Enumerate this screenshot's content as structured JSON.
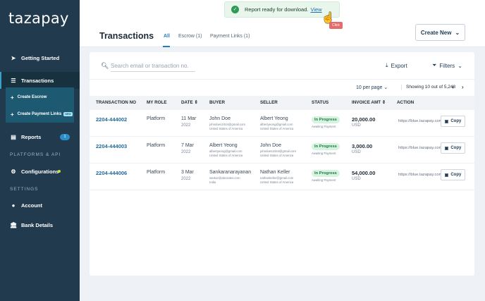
{
  "app": {
    "logo": "tazapay"
  },
  "sidebar": {
    "getting_started": "Getting Started",
    "transactions": "Transactions",
    "create_escrow": "Create Escrow",
    "create_payment_links": "Create Payment Links",
    "new_badge": "NEW",
    "reports": "Reports",
    "reports_count": "1",
    "platforms_api_label": "PLATFORMS & API",
    "configurations": "Configurations",
    "settings_label": "SETTINGS",
    "account": "Account",
    "bank_details": "Bank Details"
  },
  "header": {
    "title": "Transactions",
    "tabs": [
      {
        "label": "All"
      },
      {
        "label": "Escrow (1)"
      },
      {
        "label": "Payment Links (1)"
      }
    ],
    "create_new": "Create New"
  },
  "toast": {
    "message": "Report ready for download.",
    "link": "View",
    "tooltip": "Click"
  },
  "toolbar": {
    "search_placeholder": "Search email or transaction no.",
    "export": "Export",
    "filters": "Filters",
    "per_page": "10 per page",
    "showing": "Showing 10 out of 5,248"
  },
  "table": {
    "headers": [
      "TRANSACTION NO",
      "MY ROLE",
      "DATE",
      "BUYER",
      "SELLER",
      "STATUS",
      "INVOICE AMT",
      "ACTION"
    ],
    "rows": [
      {
        "txn": "2204-444002",
        "role": "Platform",
        "date": "11 Mar",
        "year": "2022",
        "buyer": "John Doe",
        "buyer_email": "johndoes2444@gmail.com",
        "buyer_country": "United States of America",
        "seller": "Albert Yeong",
        "seller_email": "albertyeong@gmail.com",
        "seller_country": "United States of America",
        "status": "In Progress",
        "status_sub": "Awaiting Payment",
        "amount": "20,000.00",
        "currency": "USD",
        "link": "https://blue.tazapay.com",
        "copy": "Copy"
      },
      {
        "txn": "2204-444003",
        "role": "Platform",
        "date": "7 Mar",
        "year": "2022",
        "buyer": "Albert Yeong",
        "buyer_email": "albertyeong@gmail.com",
        "buyer_country": "United States of America",
        "seller": "John Doe",
        "seller_email": "johndoes2444@gmail.com",
        "seller_country": "United States of America",
        "status": "In Progress",
        "status_sub": "Awaiting Payment",
        "amount": "3,000.00",
        "currency": "USD",
        "link": "https://blue.tazapay.com",
        "copy": "Copy"
      },
      {
        "txn": "2204-444006",
        "role": "Platform",
        "date": "3 Mar",
        "year": "2022",
        "buyer": "Sankaranarayanan",
        "buyer_email": "sankar@abcsales.com",
        "buyer_country": "India",
        "seller": "Nathan Keller",
        "seller_email": "nathankeller@gmail.com",
        "seller_country": "United States of America",
        "status": "In Progress",
        "status_sub": "Awaiting Payment",
        "amount": "54,000.00",
        "currency": "USD",
        "link": "https://blue.tazapay.com",
        "copy": "Copy"
      }
    ]
  }
}
